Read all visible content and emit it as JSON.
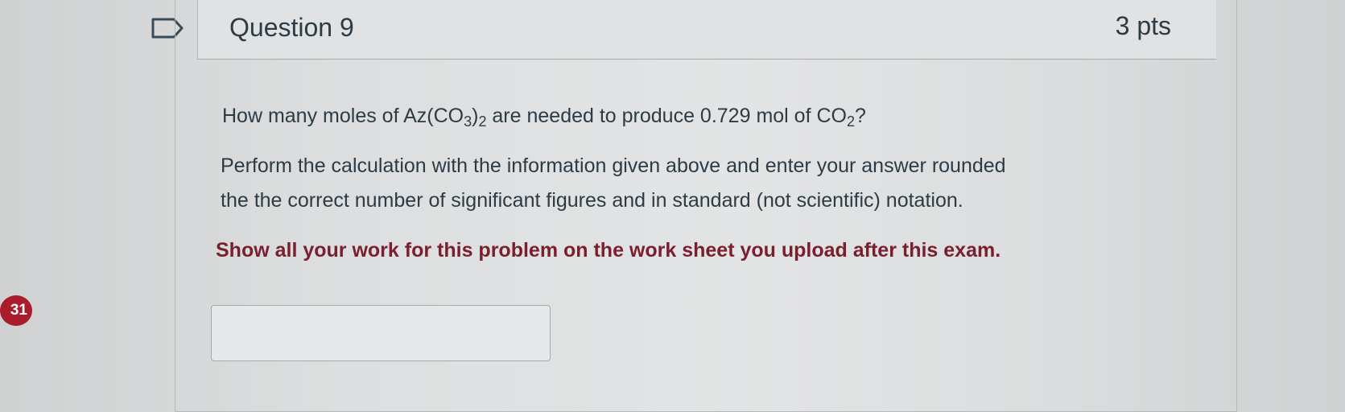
{
  "sidebar": {
    "question_badge": "31"
  },
  "question": {
    "title": "Question 9",
    "points": "3 pts",
    "line1": {
      "p1": "How many moles of Az(CO",
      "s1": "3",
      "p2": ")",
      "s2": "2",
      "p3": " are needed to produce 0.729 mol of CO",
      "s3": "2",
      "p4": "?"
    },
    "line2": "Perform the calculation with the information given above and enter your answer rounded",
    "line3": "the the correct number of significant figures and in standard (not scientific) notation.",
    "line4": "Show all your work for this problem on the work sheet you upload after this exam.",
    "answer": {
      "value": "",
      "placeholder": ""
    }
  },
  "colors": {
    "badge": "#a81c2c",
    "instruction_text": "#7a1f2d",
    "body_text": "#2d3b45"
  },
  "icons": {
    "flag": "flag-outline-icon"
  }
}
